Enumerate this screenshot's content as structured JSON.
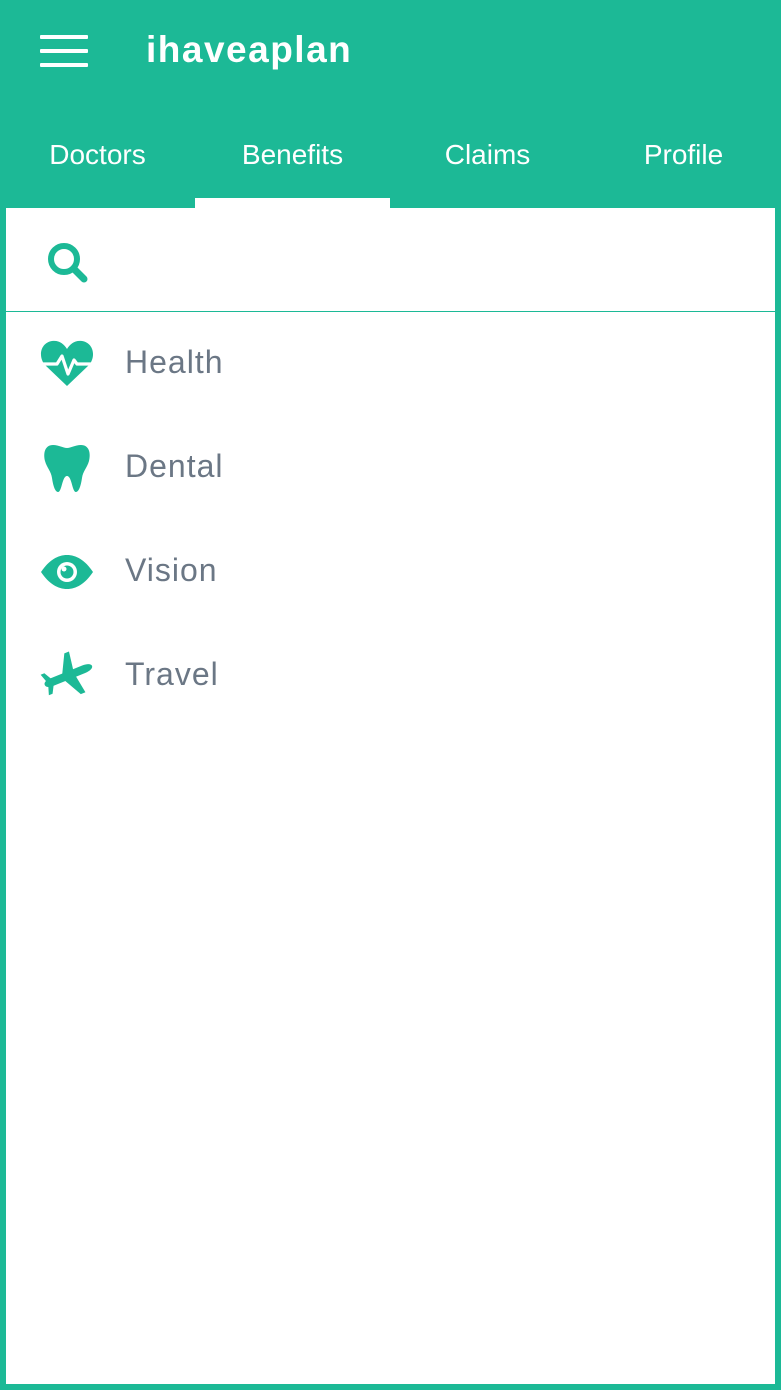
{
  "app": {
    "title": "ihaveaplan"
  },
  "colors": {
    "brand": "#1cb996",
    "text_muted": "#6b7785",
    "surface": "#ffffff"
  },
  "tabs": [
    {
      "label": "Doctors",
      "active": false
    },
    {
      "label": "Benefits",
      "active": true
    },
    {
      "label": "Claims",
      "active": false
    },
    {
      "label": "Profile",
      "active": false
    }
  ],
  "search": {
    "placeholder": "",
    "value": "",
    "icon": "search-icon"
  },
  "benefits": [
    {
      "label": "Health",
      "icon": "heartbeat-icon"
    },
    {
      "label": "Dental",
      "icon": "tooth-icon"
    },
    {
      "label": "Vision",
      "icon": "eye-icon"
    },
    {
      "label": "Travel",
      "icon": "airplane-icon"
    }
  ]
}
